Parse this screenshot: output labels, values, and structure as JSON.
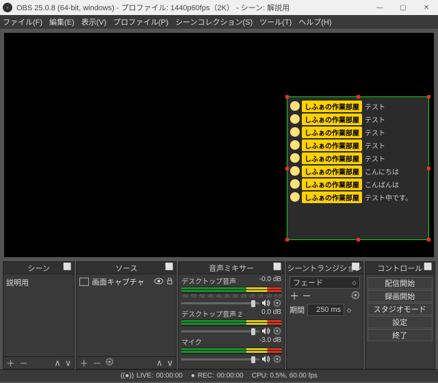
{
  "titlebar": {
    "text": "OBS 25.0.8 (64-bit, windows) - プロファイル: 1440p60fps（2K）  - シーン: 解説用"
  },
  "menubar": {
    "items": [
      "ファイル(F)",
      "編集(E)",
      "表示(V)",
      "プロファイル(P)",
      "シーンコレクション(S)",
      "ツール(T)",
      "ヘルプ(H)"
    ]
  },
  "chat": {
    "user": "しふぁの作業部屋",
    "messages": [
      "テスト",
      "テスト",
      "テスト",
      "テスト",
      "テスト",
      "こんにちは",
      "こんばんは",
      "テスト中です。"
    ]
  },
  "panels": {
    "scenes": {
      "title": "シーン",
      "items": [
        "説明用"
      ]
    },
    "sources": {
      "title": "ソース",
      "items": [
        {
          "name": "画面キャプチャ",
          "visible": true
        }
      ]
    },
    "mixer": {
      "title": "音声ミキサー",
      "ticks": [
        "-60",
        "-55",
        "-50",
        "-45",
        "-40",
        "-35",
        "-30",
        "-25",
        "-20",
        "-15",
        "-10",
        "-5",
        "0"
      ],
      "channels": [
        {
          "name": "デスクトップ音声",
          "db": "-0.0 dB"
        },
        {
          "name": "デスクトップ音声 2",
          "db": "0.0 dB"
        },
        {
          "name": "マイク",
          "db": "-3.0 dB"
        }
      ]
    },
    "transition": {
      "title": "シーントランジション",
      "type": "フェード",
      "duration_label": "期間",
      "duration_value": "250 ms"
    },
    "controls": {
      "title": "コントロール",
      "buttons": [
        "配信開始",
        "録画開始",
        "スタジオモード",
        "設定",
        "終了"
      ]
    }
  },
  "status": {
    "live_label": "LIVE:",
    "live_time": "00:00:00",
    "rec_label": "REC:",
    "rec_time": "00:00:00",
    "cpu": "CPU: 0.5%, 60.00 fps"
  }
}
